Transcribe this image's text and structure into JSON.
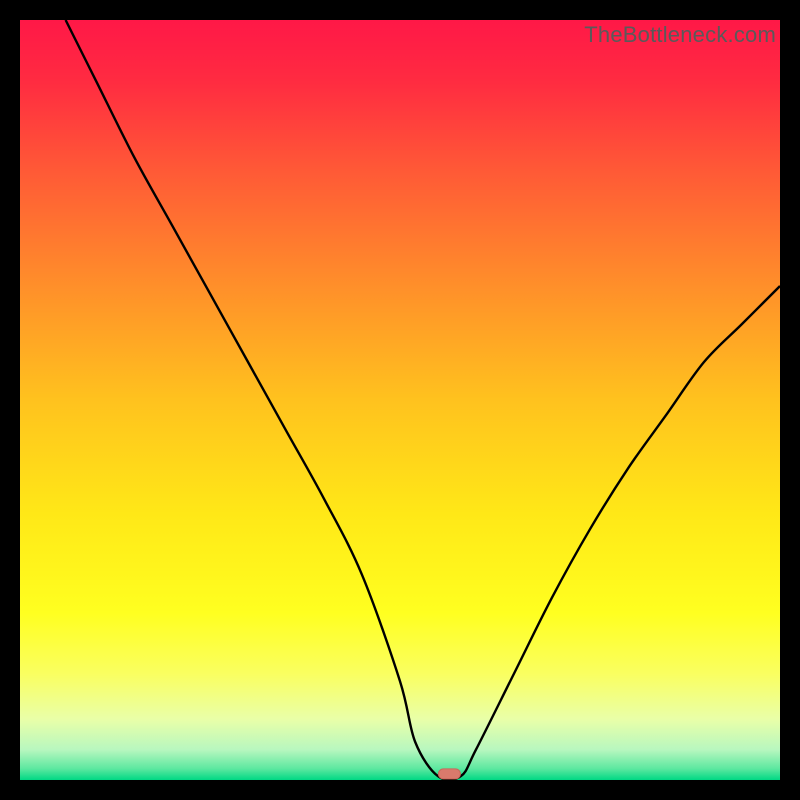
{
  "watermark": "TheBottleneck.com",
  "chart_data": {
    "type": "line",
    "title": "",
    "xlabel": "",
    "ylabel": "",
    "xlim": [
      0,
      100
    ],
    "ylim": [
      0,
      100
    ],
    "grid": false,
    "series": [
      {
        "name": "bottleneck-curve",
        "x": [
          6,
          10,
          15,
          20,
          25,
          30,
          35,
          40,
          45,
          50,
          52,
          55,
          58,
          60,
          65,
          70,
          75,
          80,
          85,
          90,
          95,
          100
        ],
        "y": [
          100,
          92,
          82,
          73,
          64,
          55,
          46,
          37,
          27,
          13,
          5,
          0.5,
          0.5,
          4,
          14,
          24,
          33,
          41,
          48,
          55,
          60,
          65
        ]
      }
    ],
    "marker": {
      "x": 56.5,
      "y": 0.8
    },
    "colors": {
      "gradient_stops": [
        {
          "offset": 0.0,
          "color": "#ff1847"
        },
        {
          "offset": 0.08,
          "color": "#ff2b41"
        },
        {
          "offset": 0.2,
          "color": "#ff5a36"
        },
        {
          "offset": 0.35,
          "color": "#ff8f2a"
        },
        {
          "offset": 0.5,
          "color": "#ffc21e"
        },
        {
          "offset": 0.65,
          "color": "#ffe817"
        },
        {
          "offset": 0.78,
          "color": "#ffff20"
        },
        {
          "offset": 0.86,
          "color": "#faff60"
        },
        {
          "offset": 0.92,
          "color": "#e9ffa8"
        },
        {
          "offset": 0.96,
          "color": "#b8f7bf"
        },
        {
          "offset": 0.985,
          "color": "#5de8a0"
        },
        {
          "offset": 1.0,
          "color": "#00d884"
        }
      ],
      "curve_stroke": "#000000",
      "marker_fill": "#d97a6c",
      "marker_stroke": "#c96a5c"
    }
  }
}
